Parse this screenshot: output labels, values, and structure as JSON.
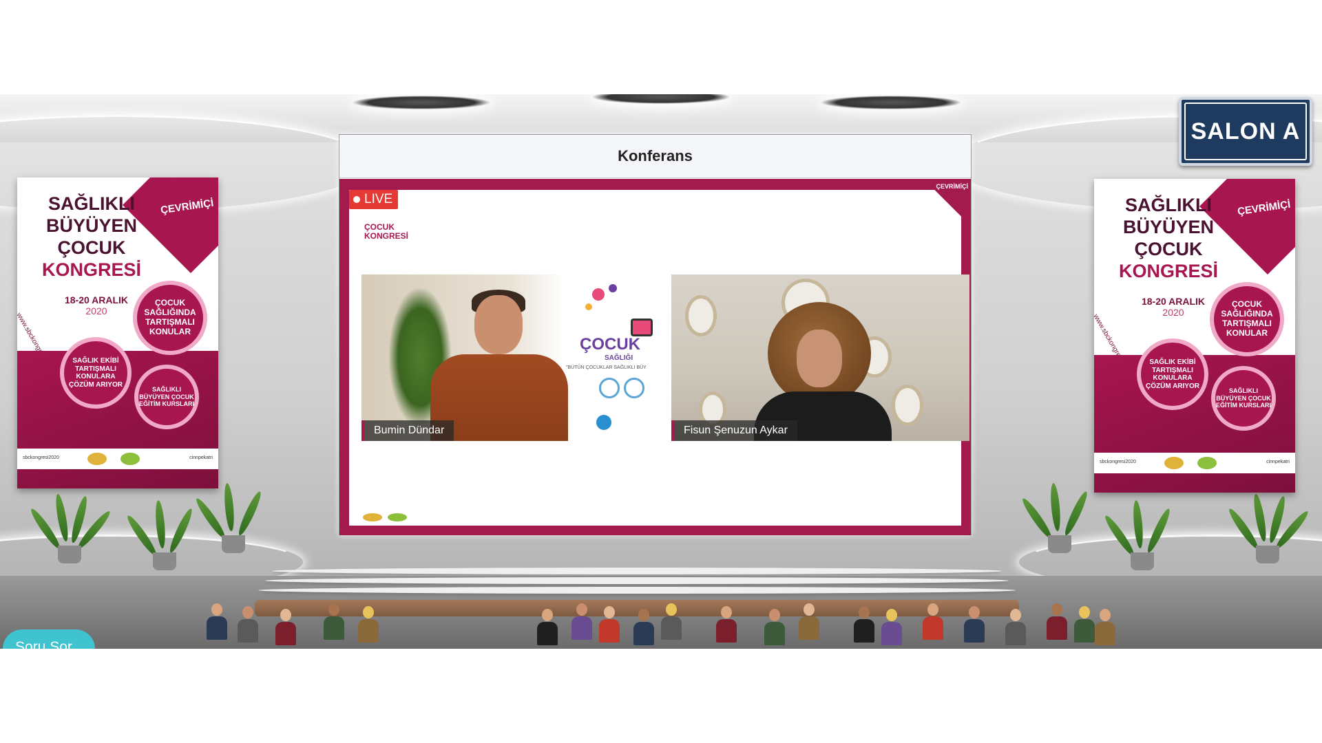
{
  "conference": {
    "header_title": "Konferans",
    "live_label": "LIVE",
    "participants": [
      {
        "name": "Bumin Dündar"
      },
      {
        "name": "Fisun Şenuzun Aykar"
      }
    ],
    "stream_logo_line1": "ÇOCUK",
    "stream_logo_line2": "KONGRESİ",
    "stream_corner": "ÇEVRİMİÇİ",
    "banner_logo": "ÇOCUK",
    "banner_logo_sub": "SAĞLIĞI",
    "banner_slogan": "\"BÜTÜN ÇOCUKLAR SAĞLIKLI BÜY"
  },
  "room_sign": "SALON  A",
  "poster": {
    "line1": "SAĞLIKLI",
    "line2": "BÜYÜYEN",
    "line3": "ÇOCUK",
    "line4": "KONGRESİ",
    "online": "ÇEVRİMİÇİ",
    "date": "18-20 ARALIK",
    "year": "2020",
    "website": "www.sbckongresi.org",
    "circle1": "ÇOCUK SAĞLIĞINDA TARTIŞMALI KONULAR",
    "circle2": "SAĞLIK EKİBİ TARTIŞMALI KONULARA ÇÖZÜM ARIYOR",
    "circle3": "SAĞLIKLI BÜYÜYEN ÇOCUK EĞİTİM KURSLARI",
    "social_left": "sbckongresi2020",
    "social_right": "cinnpekatri"
  },
  "ask_button": "Soru Sor",
  "colors": {
    "brand": "#a8164f",
    "live": "#e53935",
    "ask_button": "#3ec3cf",
    "sign": "#1f3a5f"
  }
}
